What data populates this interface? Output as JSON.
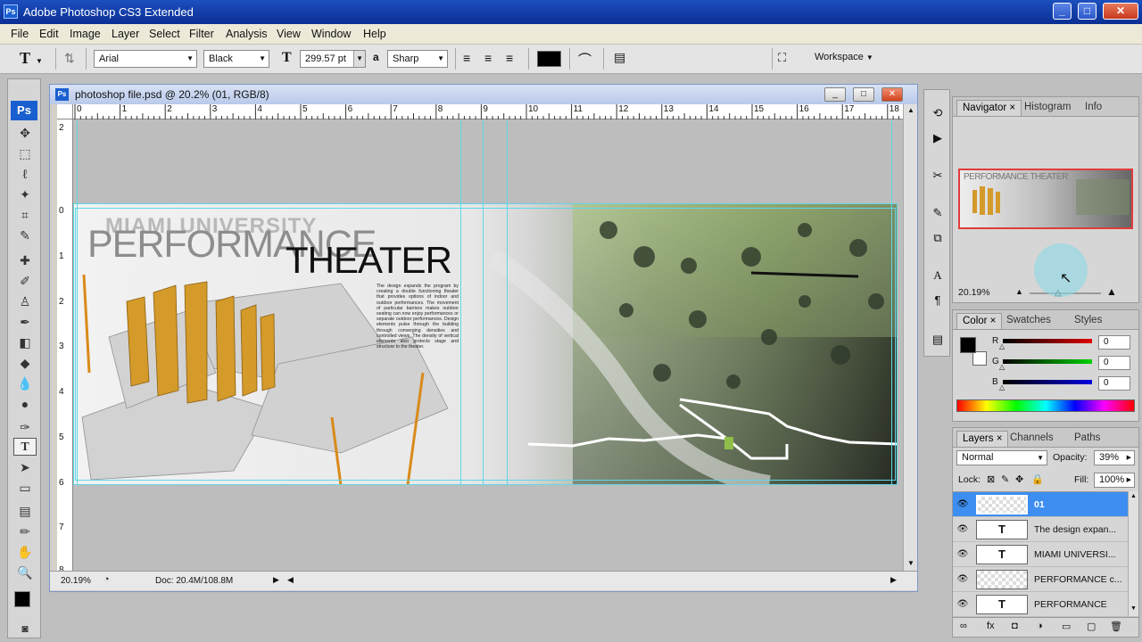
{
  "app": {
    "title": "Adobe Photoshop CS3 Extended",
    "logo": "Ps"
  },
  "window_controls": {
    "minimize": "_",
    "maximize": "□",
    "close": "✕"
  },
  "menu": [
    "File",
    "Edit",
    "Image",
    "Layer",
    "Select",
    "Filter",
    "Analysis",
    "View",
    "Window",
    "Help"
  ],
  "options": {
    "tool_icon": "T",
    "font_family": "Arial",
    "font_style": "Black",
    "font_size": "299.57 pt",
    "aa_icon": "a",
    "antialias": "Sharp",
    "workspace": "Workspace"
  },
  "document": {
    "title": "photoshop file.psd @ 20.2% (01, RGB/8)",
    "doc_icon": "Ps",
    "zoom": "20.19%",
    "doc_size": "Doc: 20.4M/108.8M",
    "ruler_top": [
      "0",
      "1",
      "2",
      "3",
      "4",
      "5",
      "6",
      "7",
      "8",
      "9",
      "10",
      "11",
      "12",
      "13",
      "14",
      "15",
      "16",
      "17",
      "18"
    ],
    "ruler_left": [
      "2",
      "0",
      "1",
      "2",
      "3",
      "4",
      "5",
      "6",
      "7",
      "8"
    ],
    "poster": {
      "university": "MIAMI UNIVERSITY",
      "title1": "PERFORMANCE",
      "title2": "THEATER",
      "body": "The design expands the program by creating a double functioning theater that provides options of indoor and outdoor performances. The movement of particular barriers makes outdoor seating can now enjoy performances or separate outdoor performances. Design elements pulse through the building through converging densities and controlled views. The density of vertical elements also protects stage and structure to the theater."
    }
  },
  "navigator": {
    "tabs": [
      "Navigator",
      "Histogram",
      "Info"
    ],
    "zoom": "20.19%",
    "thumb_title": "PERFORMANCE THEATER"
  },
  "color": {
    "tabs": [
      "Color",
      "Swatches",
      "Styles"
    ],
    "channels": [
      {
        "label": "R",
        "value": "0"
      },
      {
        "label": "G",
        "value": "0"
      },
      {
        "label": "B",
        "value": "0"
      }
    ],
    "foreground": "#000000",
    "background": "#ffffff"
  },
  "layers": {
    "tabs": [
      "Layers",
      "Channels",
      "Paths"
    ],
    "blend_mode": "Normal",
    "opacity_label": "Opacity:",
    "opacity": "39%",
    "lock_label": "Lock:",
    "fill_label": "Fill:",
    "fill": "100%",
    "items": [
      {
        "name": "01",
        "type": "raster",
        "selected": true
      },
      {
        "name": "The design expan...",
        "type": "text",
        "selected": false
      },
      {
        "name": "MIAMI UNIVERSI...",
        "type": "text",
        "selected": false
      },
      {
        "name": "PERFORMANCE c...",
        "type": "raster",
        "selected": false
      },
      {
        "name": "PERFORMANCE",
        "type": "text",
        "selected": false
      }
    ]
  },
  "colors": {
    "selection": "#3d8ef0",
    "guide": "#5fd8e6",
    "accent_green": "#8fbf4a"
  }
}
